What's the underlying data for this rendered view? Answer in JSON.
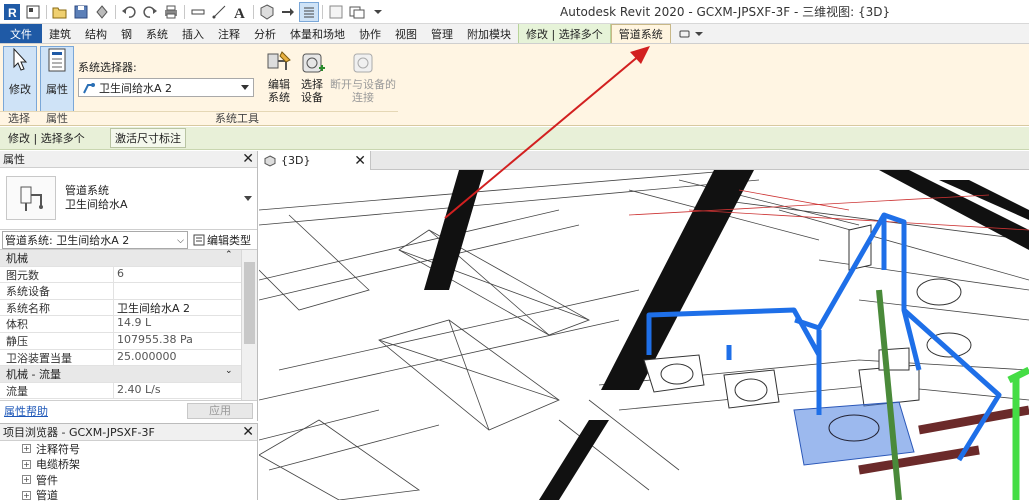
{
  "window": {
    "title": "Autodesk Revit 2020 - GCXM-JPSXF-3F - 三维视图: {3D}"
  },
  "tabs": [
    {
      "label": "文件"
    },
    {
      "label": "建筑"
    },
    {
      "label": "结构"
    },
    {
      "label": "钢"
    },
    {
      "label": "系统"
    },
    {
      "label": "插入"
    },
    {
      "label": "注释"
    },
    {
      "label": "分析"
    },
    {
      "label": "体量和场地"
    },
    {
      "label": "协作"
    },
    {
      "label": "视图"
    },
    {
      "label": "管理"
    },
    {
      "label": "附加模块"
    },
    {
      "label": "修改 | 选择多个"
    },
    {
      "label": "管道系统"
    }
  ],
  "ribbon": {
    "modify_label": "修改",
    "properties_label": "属性",
    "system_selector_label": "系统选择器:",
    "system_selector_value": "卫生间给水A 2",
    "edit_system_label": "编辑系统",
    "select_equipment_label": "选择设备",
    "disconnect_label": "断开与设备的连接",
    "group_select": "选择",
    "group_properties": "属性",
    "group_system_tools": "系统工具"
  },
  "options_bar": {
    "context_label": "修改 | 选择多个",
    "activate_dims_label": "激活尺寸标注"
  },
  "properties": {
    "title": "属性",
    "type_line1": "管道系统",
    "type_line2": "卫生间给水A",
    "instance_selector": "管道系统: 卫生间给水A 2",
    "edit_type_label": "编辑类型",
    "categories": {
      "mechanical": "机械",
      "mech_flow": "机械 - 流量"
    },
    "rows": [
      {
        "key": "图元数",
        "value": "6"
      },
      {
        "key": "系统设备",
        "value": ""
      },
      {
        "key": "系统名称",
        "value": "卫生间给水A 2"
      },
      {
        "key": "体积",
        "value": "14.9 L"
      },
      {
        "key": "静压",
        "value": "107955.38 Pa"
      },
      {
        "key": "卫浴装置当量",
        "value": "25.000000"
      }
    ],
    "flow_row": {
      "key": "流量",
      "value": "2.40 L/s"
    },
    "help_link": "属性帮助",
    "apply_label": "应用"
  },
  "project_browser": {
    "title": "项目浏览器 - GCXM-JPSXF-3F",
    "items": [
      {
        "label": "注释符号"
      },
      {
        "label": "电缆桥架"
      },
      {
        "label": "管件"
      },
      {
        "label": "管道"
      }
    ]
  },
  "view_tab": {
    "label": "{3D}"
  },
  "colors": {
    "file_tab": "#1f5aa6",
    "ribbon_bg": "#fff5e3",
    "context_tab": "#e6f3d8",
    "selected_pipe": "#1e6fe8",
    "annotation_arrow": "#d22020"
  }
}
